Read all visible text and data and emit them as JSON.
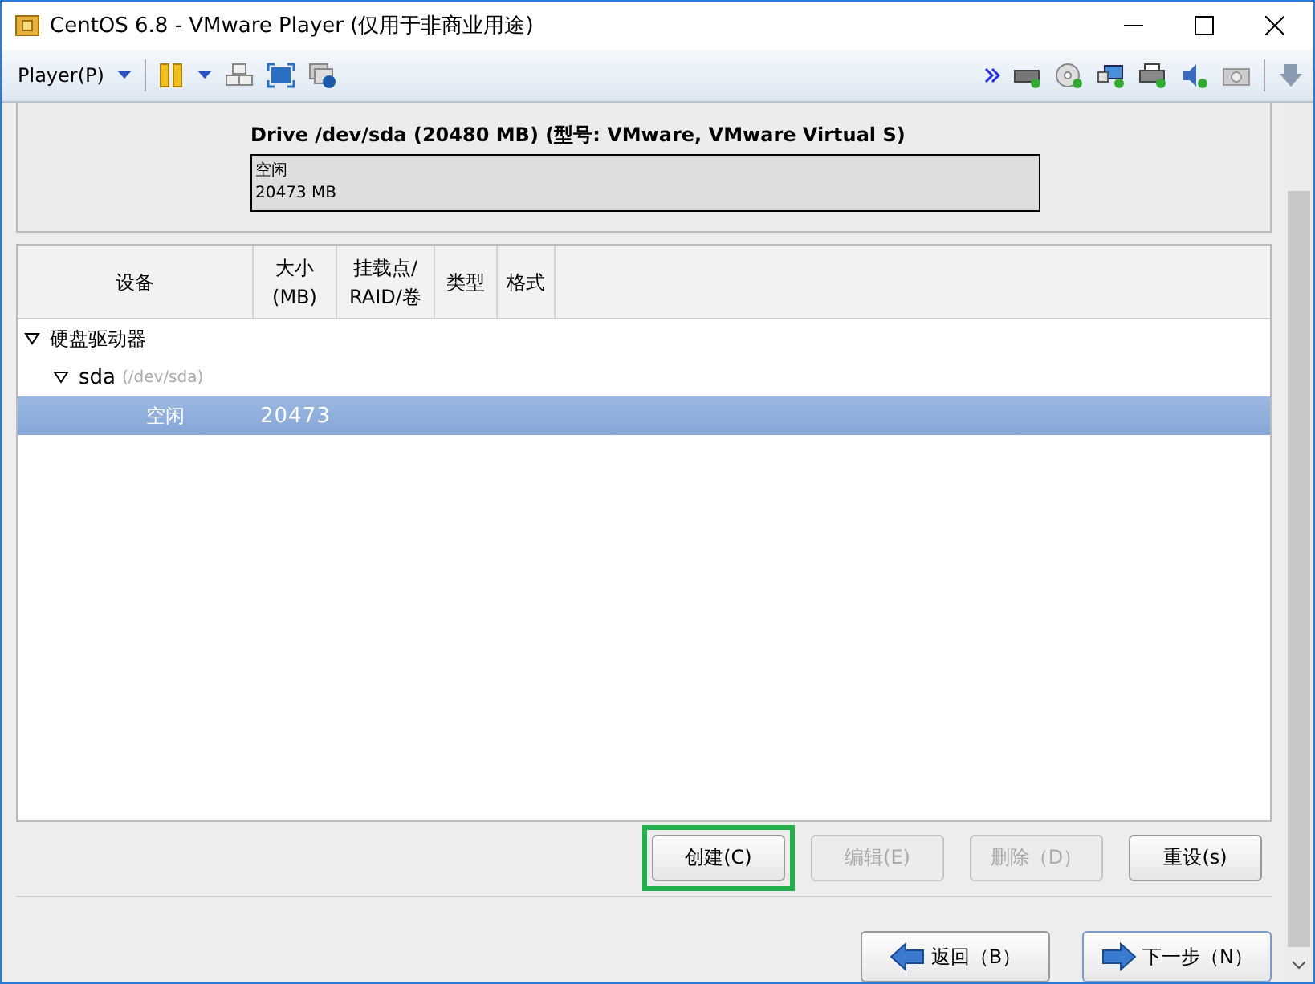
{
  "window": {
    "title": "CentOS 6.8 - VMware Player (仅用于非商业用途)"
  },
  "toolbar": {
    "menu": "Player(P)"
  },
  "drive": {
    "title": "Drive /dev/sda (20480 MB) (型号: VMware, VMware Virtual S)",
    "segment": {
      "label": "空闲",
      "size": "20473 MB"
    }
  },
  "table": {
    "columns": [
      {
        "lines": [
          "设备"
        ]
      },
      {
        "lines": [
          "大小",
          "(MB)"
        ]
      },
      {
        "lines": [
          "挂载点/",
          "RAID/卷"
        ]
      },
      {
        "lines": [
          "类型"
        ]
      },
      {
        "lines": [
          "格式"
        ]
      }
    ],
    "rows": [
      {
        "device": "硬盘驱动器",
        "expanded": true,
        "selected": false,
        "children": [
          {
            "device": "sda",
            "path": "(/dev/sda)",
            "expanded": true,
            "selected": false,
            "children": [
              {
                "device": "空闲",
                "size": "20473",
                "selected": true
              }
            ]
          }
        ]
      }
    ]
  },
  "buttons": [
    {
      "label": "创建(C)",
      "disabled": false,
      "highlighted": true
    },
    {
      "label": "编辑(E)",
      "disabled": true,
      "highlighted": false
    },
    {
      "label": "删除（D）",
      "disabled": true,
      "highlighted": false
    },
    {
      "label": "重设(s)",
      "disabled": false,
      "highlighted": false
    }
  ],
  "nav": [
    {
      "label": "返回（B）",
      "kind": "back"
    },
    {
      "label": "下一步（N）",
      "kind": "next"
    }
  ]
}
